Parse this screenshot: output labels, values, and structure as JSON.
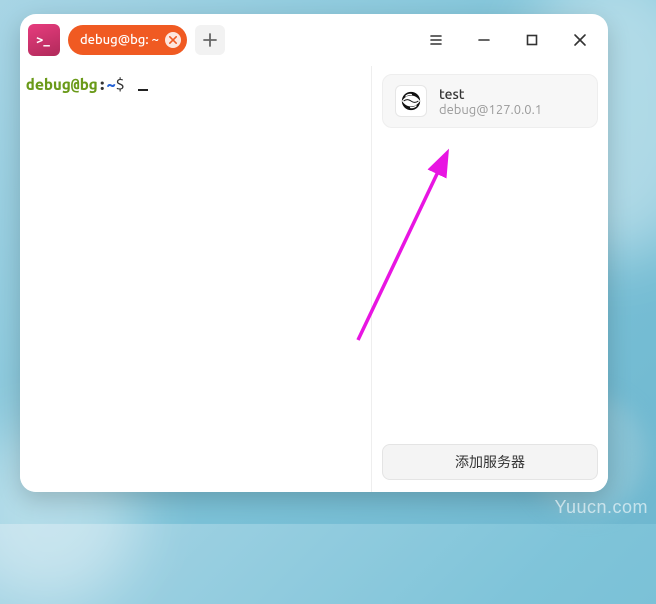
{
  "app": {
    "badge_glyph": ">_"
  },
  "tab": {
    "label": "debug@bg: ~"
  },
  "terminal": {
    "prompt_user": "debug@bg",
    "prompt_sep": ":",
    "prompt_path": "~",
    "prompt_dollar": "$"
  },
  "sidebar": {
    "server": {
      "title": "test",
      "subtitle": "debug@127.0.0.1"
    },
    "add_button_label": "添加服务器"
  },
  "watermark": "Yuucn.com",
  "colors": {
    "accent_tab": "#f05a22",
    "arrow": "#e815e2"
  }
}
